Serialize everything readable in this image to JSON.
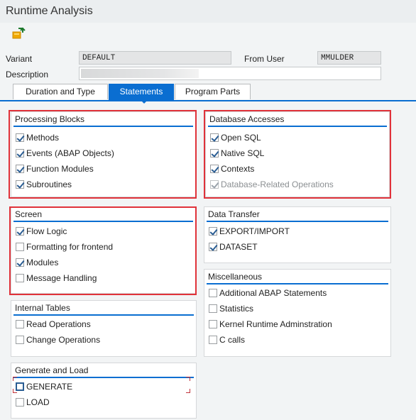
{
  "window": {
    "title": "Runtime Analysis"
  },
  "toolbar": {
    "icon": "transport-icon"
  },
  "header": {
    "variant_label": "Variant",
    "variant_value": "DEFAULT",
    "from_user_label": "From User",
    "from_user_value": "MMULDER",
    "description_label": "Description",
    "description_value": ""
  },
  "tabs": [
    {
      "label": "Duration and Type",
      "active": false
    },
    {
      "label": "Statements",
      "active": true
    },
    {
      "label": "Program Parts",
      "active": false
    }
  ],
  "groups": {
    "processing_blocks": {
      "title": "Processing Blocks",
      "items": [
        {
          "label": "Methods",
          "checked": true
        },
        {
          "label": "Events (ABAP Objects)",
          "checked": true
        },
        {
          "label": "Function Modules",
          "checked": true
        },
        {
          "label": "Subroutines",
          "checked": true
        }
      ]
    },
    "database_accesses": {
      "title": "Database Accesses",
      "items": [
        {
          "label": "Open SQL",
          "checked": true
        },
        {
          "label": "Native SQL",
          "checked": true
        },
        {
          "label": "Contexts",
          "checked": true
        },
        {
          "label": "Database-Related Operations",
          "checked": true,
          "disabled": true
        }
      ]
    },
    "screen": {
      "title": "Screen",
      "items": [
        {
          "label": "Flow Logic",
          "checked": true
        },
        {
          "label": "Formatting for frontend",
          "checked": false
        },
        {
          "label": "Modules",
          "checked": true
        },
        {
          "label": "Message Handling",
          "checked": false
        }
      ]
    },
    "data_transfer": {
      "title": "Data Transfer",
      "items": [
        {
          "label": "EXPORT/IMPORT",
          "checked": true
        },
        {
          "label": "DATASET",
          "checked": true
        }
      ]
    },
    "internal_tables": {
      "title": "Internal Tables",
      "items": [
        {
          "label": "Read Operations",
          "checked": false
        },
        {
          "label": "Change Operations",
          "checked": false
        }
      ]
    },
    "miscellaneous": {
      "title": "Miscellaneous",
      "items": [
        {
          "label": "Additional ABAP Statements",
          "checked": false
        },
        {
          "label": "Statistics",
          "checked": false
        },
        {
          "label": "Kernel Runtime Adminstration",
          "checked": false
        },
        {
          "label": "C calls",
          "checked": false
        }
      ]
    },
    "generate_and_load": {
      "title": "Generate and Load",
      "items": [
        {
          "label": "GENERATE",
          "checked": false,
          "focused": true
        },
        {
          "label": "LOAD",
          "checked": false
        }
      ]
    }
  },
  "colors": {
    "accent": "#0a6ed1",
    "highlight": "#e0323a"
  }
}
